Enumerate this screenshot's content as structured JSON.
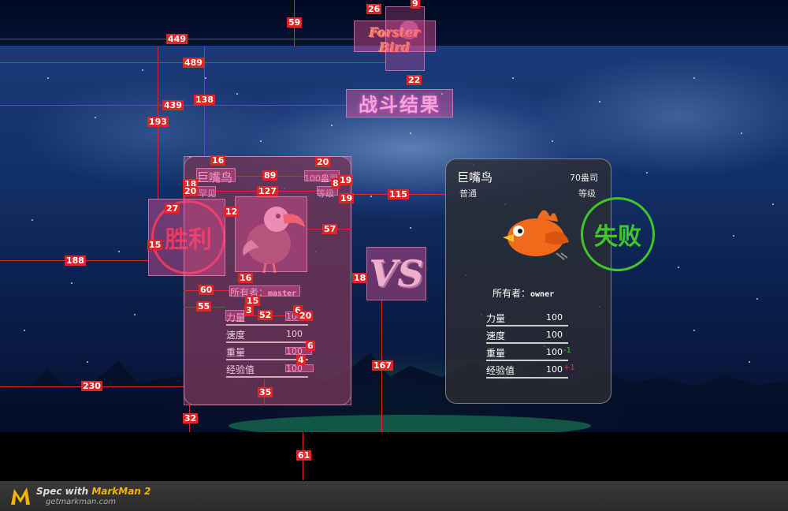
{
  "header": {
    "logo_text": "Forster Bird",
    "battle_title": "战斗结果"
  },
  "left_card": {
    "name": "巨嘴鸟",
    "price": "100盎司",
    "rarity": "罕见",
    "level": "等级",
    "result": "胜利",
    "owner_label": "所有者：",
    "owner_name": "master",
    "stats": [
      {
        "label": "力量",
        "value": "100",
        "delta": ""
      },
      {
        "label": "速度",
        "value": "100",
        "delta": ""
      },
      {
        "label": "重量",
        "value": "100",
        "delta": ""
      },
      {
        "label": "经验值",
        "value": "100",
        "delta": ""
      }
    ]
  },
  "vs_text": "VS",
  "right_card": {
    "name": "巨嘴鸟",
    "price": "70盎司",
    "rarity": "普通",
    "level": "等级",
    "result": "失败",
    "owner_label": "所有者：",
    "owner_name": "owner",
    "stats": [
      {
        "label": "力量",
        "value": "100",
        "delta": ""
      },
      {
        "label": "速度",
        "value": "100",
        "delta": ""
      },
      {
        "label": "重量",
        "value": "100",
        "delta": "-1",
        "delta_color": "#3fc72a"
      },
      {
        "label": "经验值",
        "value": "100",
        "delta": "+1",
        "delta_color": "#e8293a"
      }
    ]
  },
  "footer": {
    "spec_with": "Spec with",
    "brand": "MarkMan 2",
    "url": "getmarkman.com"
  },
  "measurements": [
    "26",
    "9",
    "59",
    "449",
    "489",
    "22",
    "439",
    "138",
    "193",
    "16",
    "20",
    "89",
    "19",
    "18",
    "20",
    "127",
    "8",
    "19",
    "115",
    "27",
    "12",
    "57",
    "15",
    "188",
    "16",
    "18",
    "60",
    "15",
    "3",
    "6",
    "55",
    "52",
    "20",
    "6",
    "4",
    "167",
    "35",
    "230",
    "32",
    "61"
  ]
}
